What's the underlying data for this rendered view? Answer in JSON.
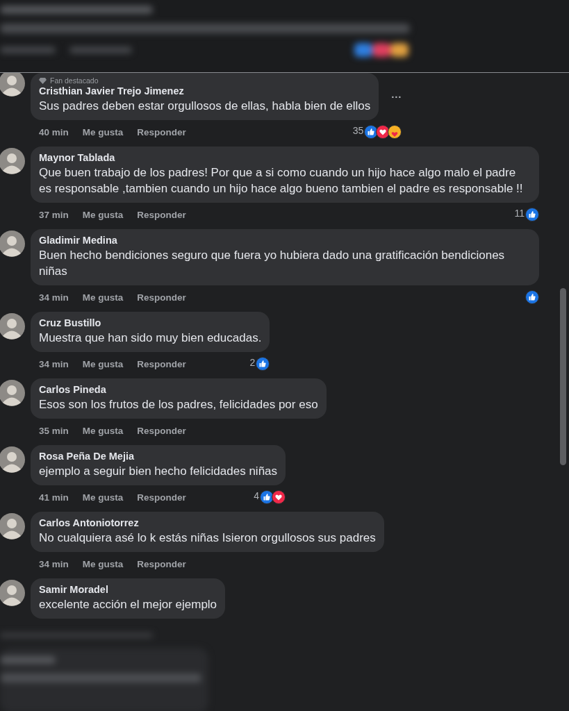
{
  "comments": [
    {
      "badge": "Fan destacado",
      "author": "Cristhian Javier Trejo Jimenez",
      "text": "Sus padres deben estar orgullosos de ellas, habla bien de ellos",
      "menu": "···",
      "time": "40 min",
      "actions": [
        "Me gusta",
        "Responder"
      ],
      "reactions": {
        "count": "35",
        "items": [
          {
            "kind": "like"
          },
          {
            "kind": "love"
          },
          {
            "kind": "care"
          }
        ]
      }
    },
    {
      "author": "Maynor Tablada",
      "text": "Que buen trabajo de los padres! Por que a si como cuando un hijo hace algo malo el padre es responsable ,tambien cuando un hijo hace algo bueno tambien el padre es responsable !!",
      "time": "37 min",
      "actions": [
        "Me gusta",
        "Responder"
      ],
      "reactions": {
        "count": "11",
        "items": [
          {
            "kind": "like"
          }
        ]
      }
    },
    {
      "author": "Gladimir Medina",
      "text": "Buen hecho bendiciones seguro que fuera yo hubiera dado una gratificación bendiciones niñas",
      "time": "34 min",
      "actions": [
        "Me gusta",
        "Responder"
      ],
      "reactions": {
        "items": [
          {
            "kind": "like"
          }
        ]
      }
    },
    {
      "author": "Cruz Bustillo",
      "text": "Muestra que han sido muy bien educadas.",
      "time": "34 min",
      "actions": [
        "Me gusta",
        "Responder"
      ],
      "reactions": {
        "count": "2",
        "items": [
          {
            "kind": "like"
          }
        ]
      }
    },
    {
      "author": "Carlos Pineda",
      "text": "Esos son los frutos de los padres, felicidades por eso",
      "time": "35 min",
      "actions": [
        "Me gusta",
        "Responder"
      ]
    },
    {
      "author": "Rosa Peña De Mejia",
      "text": "ejemplo a seguir bien hecho felicidades niñas",
      "time": "41 min",
      "actions": [
        "Me gusta",
        "Responder"
      ],
      "reactions": {
        "count": "4",
        "items": [
          {
            "kind": "like"
          },
          {
            "kind": "love"
          }
        ]
      }
    },
    {
      "author": "Carlos Antoniotorrez",
      "text": "No cualquiera asé lo k estás niñas Isieron orgullosos sus padres",
      "time": "34 min",
      "actions": [
        "Me gusta",
        "Responder"
      ]
    },
    {
      "author": "Samir Moradel",
      "text": "excelente acción el mejor ejemplo"
    }
  ]
}
